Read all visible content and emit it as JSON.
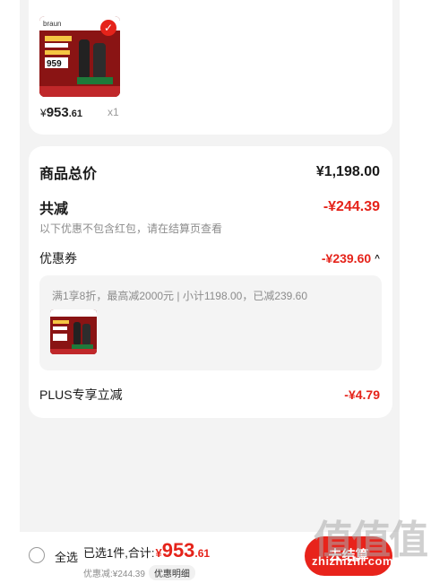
{
  "product": {
    "brand": "braun",
    "price_main": "953",
    "price_cents": ".61",
    "price_symbol": "¥",
    "quantity": "x1",
    "image_text": "959"
  },
  "summary": {
    "goods_total_label": "商品总价",
    "goods_total_value": "¥1,198.00",
    "total_reduction_label": "共减",
    "total_reduction_value": "-¥244.39",
    "note": "以下优惠不包含红包，请在结算页查看",
    "coupon_label": "优惠券",
    "coupon_value": "-¥239.60",
    "coupon_caret": "^",
    "coupon_desc": "满1享8折，最高减2000元 | 小计1198.00，已减239.60",
    "plus_label": "PLUS专享立减",
    "plus_value": "-¥4.79"
  },
  "bottom_bar": {
    "select_all": "全选",
    "selected_prefix": "已选1件,合计:",
    "total_symbol": "¥",
    "total_main": "953",
    "total_cents": ".61",
    "discount_text": "优惠减:¥244.39",
    "detail_label": "优惠明细",
    "checkout_label": "去结算"
  },
  "watermark": {
    "big": "值值值",
    "small": "zhizhizhi.com"
  },
  "colors": {
    "accent_red": "#e5231a",
    "page_bg": "#f3f3f3"
  }
}
